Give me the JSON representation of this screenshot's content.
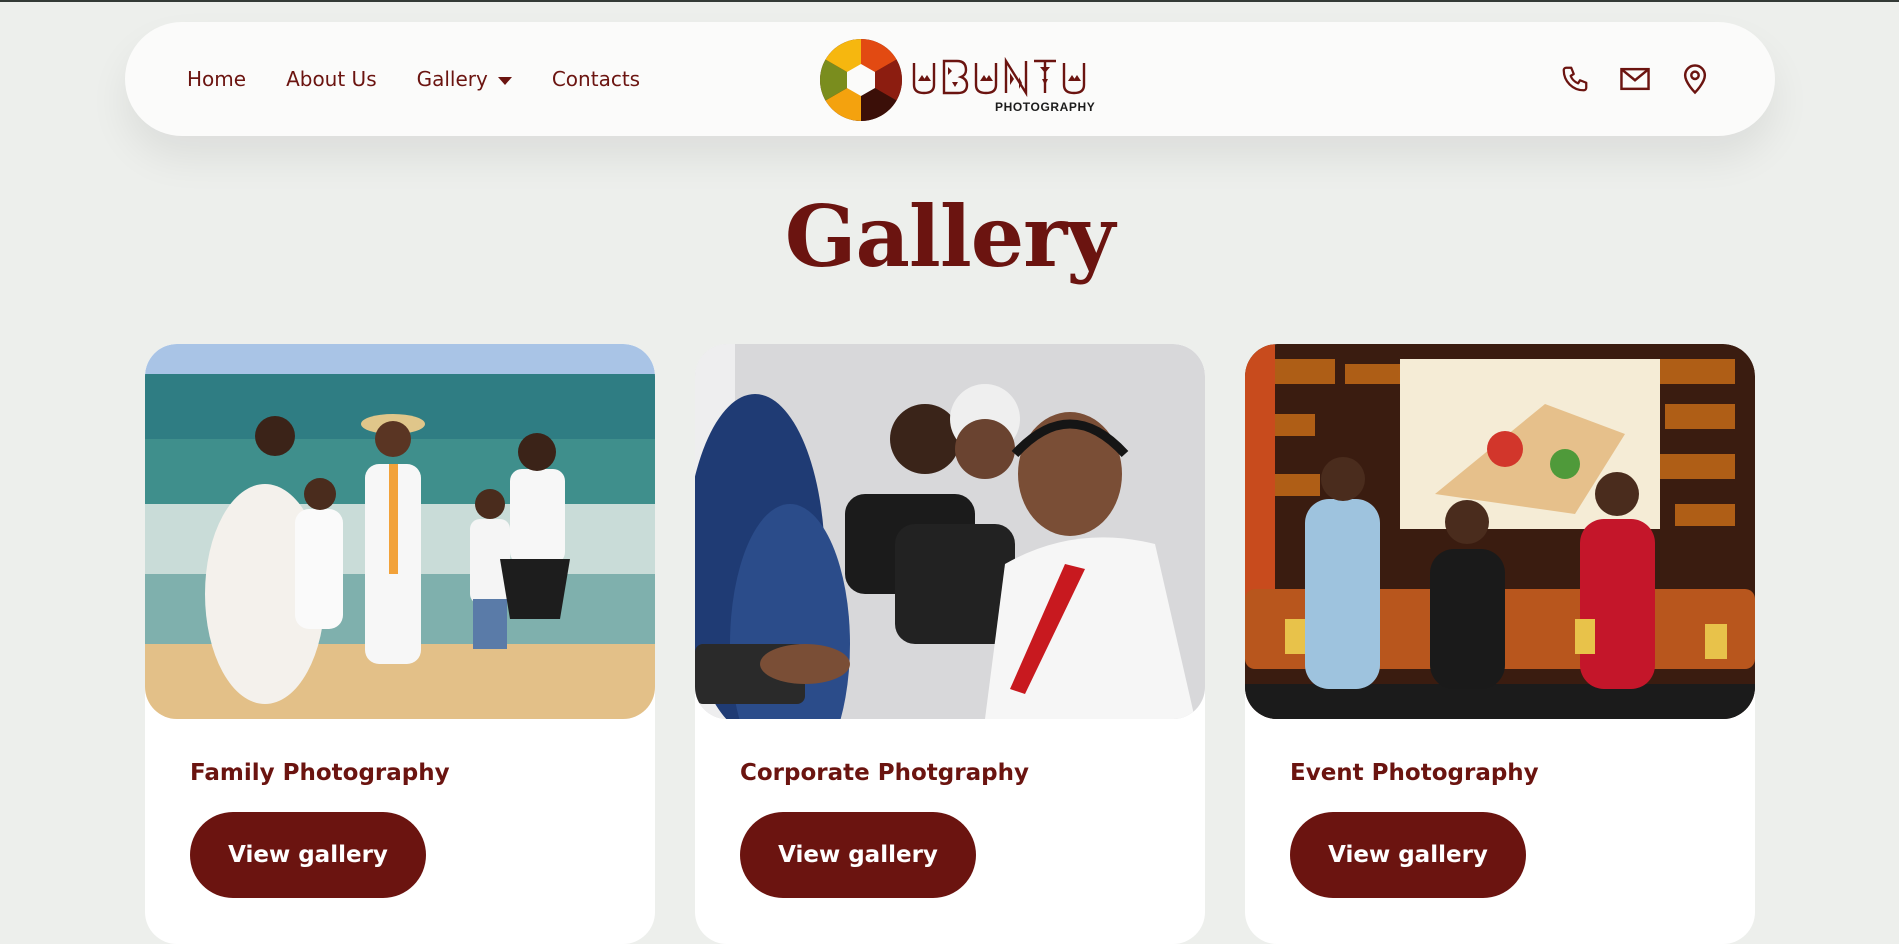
{
  "nav": {
    "links": [
      {
        "label": "Home"
      },
      {
        "label": "About Us"
      },
      {
        "label": "Gallery"
      },
      {
        "label": "Contacts"
      }
    ],
    "icons": [
      "phone-icon",
      "mail-icon",
      "location-pin-icon"
    ]
  },
  "logo": {
    "wordmark": "UBUNTU",
    "subtitle": "PHOTOGRAPHY"
  },
  "page": {
    "title": "Gallery"
  },
  "cards": [
    {
      "title": "Family Photography",
      "button": "View gallery"
    },
    {
      "title": "Corporate Photgraphy",
      "button": "View gallery"
    },
    {
      "title": "Event Photography",
      "button": "View gallery"
    }
  ],
  "colors": {
    "brand": "#6b1410",
    "background": "#edefec",
    "nav_background": "#fbfbfa"
  }
}
